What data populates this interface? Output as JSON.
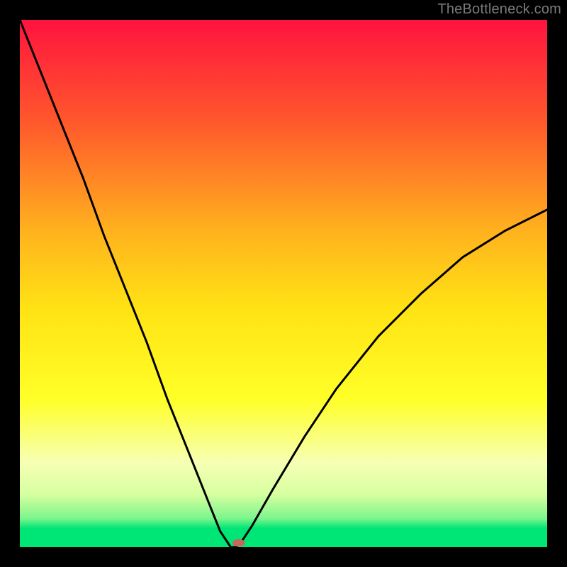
{
  "watermark": "TheBottleneck.com",
  "chart_data": {
    "type": "line",
    "title": "",
    "xlabel": "",
    "ylabel": "",
    "xlim": [
      0,
      100
    ],
    "ylim": [
      0,
      100
    ],
    "grid": false,
    "background": "heatmap-gradient",
    "gradient_stops": [
      {
        "pos": 0.0,
        "color": "#ff133f"
      },
      {
        "pos": 0.2,
        "color": "#ff5a2b"
      },
      {
        "pos": 0.4,
        "color": "#ffb21e"
      },
      {
        "pos": 0.55,
        "color": "#ffe314"
      },
      {
        "pos": 0.72,
        "color": "#ffff28"
      },
      {
        "pos": 0.84,
        "color": "#f6ffb4"
      },
      {
        "pos": 0.9,
        "color": "#d6ffa0"
      },
      {
        "pos": 0.946,
        "color": "#7bf58c"
      },
      {
        "pos": 0.964,
        "color": "#00e676"
      },
      {
        "pos": 1.0,
        "color": "#00e676"
      }
    ],
    "series": [
      {
        "name": "bottleneck-curve",
        "x": [
          0,
          4,
          8,
          12,
          16,
          20,
          24,
          28,
          32,
          36,
          38,
          40,
          41,
          42,
          44,
          48,
          54,
          60,
          68,
          76,
          84,
          92,
          100
        ],
        "y": [
          100,
          90,
          80,
          70,
          59,
          49,
          39,
          28,
          18,
          8,
          3,
          0,
          0,
          1,
          4,
          11,
          21,
          30,
          40,
          48,
          55,
          60,
          64
        ]
      }
    ],
    "marker": {
      "x": 41.5,
      "y": 0,
      "rx": 1.2,
      "ry": 0.7,
      "color": "#c26a5a"
    }
  }
}
